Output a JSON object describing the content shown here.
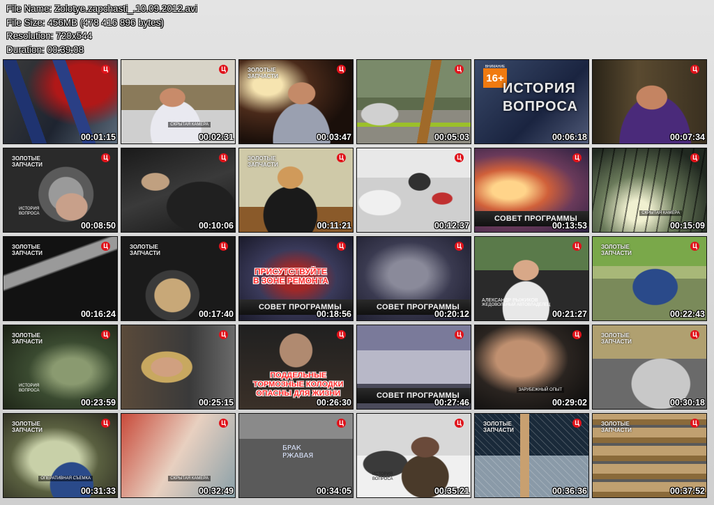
{
  "info": {
    "file_name": "File Name: Zolotye.zapchasti_.10.09.2012.avi",
    "file_size": "File Size: 456MB (478 416 896 bytes)",
    "resolution": "Resolution: 720x544",
    "duration": "Duration: 00:39:08"
  },
  "overlay": {
    "channel_logo": "Ц",
    "show_logo": "ЗОЛОТЫЕ\nЗАПЧАСТИ",
    "hidden_camera": "СКРЫТАЯ КАМЕРА",
    "history_of_question": "ИСТОРИЯ\nВОПРОСА",
    "age_rating": "16+",
    "age_top": "ВНИМАНИЕ",
    "advice": "СОВЕТ ПРОГРАММЫ",
    "present_repair": "ПРИСУТСТВУЙТЕ\nВ ЗОНЕ РЕМОНТА",
    "fake_pads": "ПОДДЕЛЬНЫЕ\nТОРМОЗНЫЕ КОЛОДКИ\nОПАСНЫ ДЛЯ ЖИЗНИ",
    "history_small": "ИСТОРИЯ\nВОПРОСА",
    "name": "АЛЕКСАНДР РЫЖИКОВ",
    "name_role": "ЖЕДОВОЛЬНЫЙ АВТОВЛАДЕЛЕЦ",
    "foreign": "ЗАРУБЕЖНЫЙ ОПЫТ",
    "operative": "ОПЕРАТИВНАЯ СЪЕМКА",
    "chalk": "БРАК\nРЖАВАЯ"
  },
  "thumbnails": [
    {
      "time": "00:01:15"
    },
    {
      "time": "00:02:31"
    },
    {
      "time": "00:03:47"
    },
    {
      "time": "00:05:03"
    },
    {
      "time": "00:06:18"
    },
    {
      "time": "00:07:34"
    },
    {
      "time": "00:08:50"
    },
    {
      "time": "00:10:06"
    },
    {
      "time": "00:11:21"
    },
    {
      "time": "00:12:37"
    },
    {
      "time": "00:13:53"
    },
    {
      "time": "00:15:09"
    },
    {
      "time": "00:16:24"
    },
    {
      "time": "00:17:40"
    },
    {
      "time": "00:18:56"
    },
    {
      "time": "00:20:12"
    },
    {
      "time": "00:21:27"
    },
    {
      "time": "00:22:43"
    },
    {
      "time": "00:23:59"
    },
    {
      "time": "00:25:15"
    },
    {
      "time": "00:26:30"
    },
    {
      "time": "00:27:46"
    },
    {
      "time": "00:29:02"
    },
    {
      "time": "00:30:18"
    },
    {
      "time": "00:31:33"
    },
    {
      "time": "00:32:49"
    },
    {
      "time": "00:34:05"
    },
    {
      "time": "00:35:21"
    },
    {
      "time": "00:36:36"
    },
    {
      "time": "00:37:52"
    }
  ]
}
